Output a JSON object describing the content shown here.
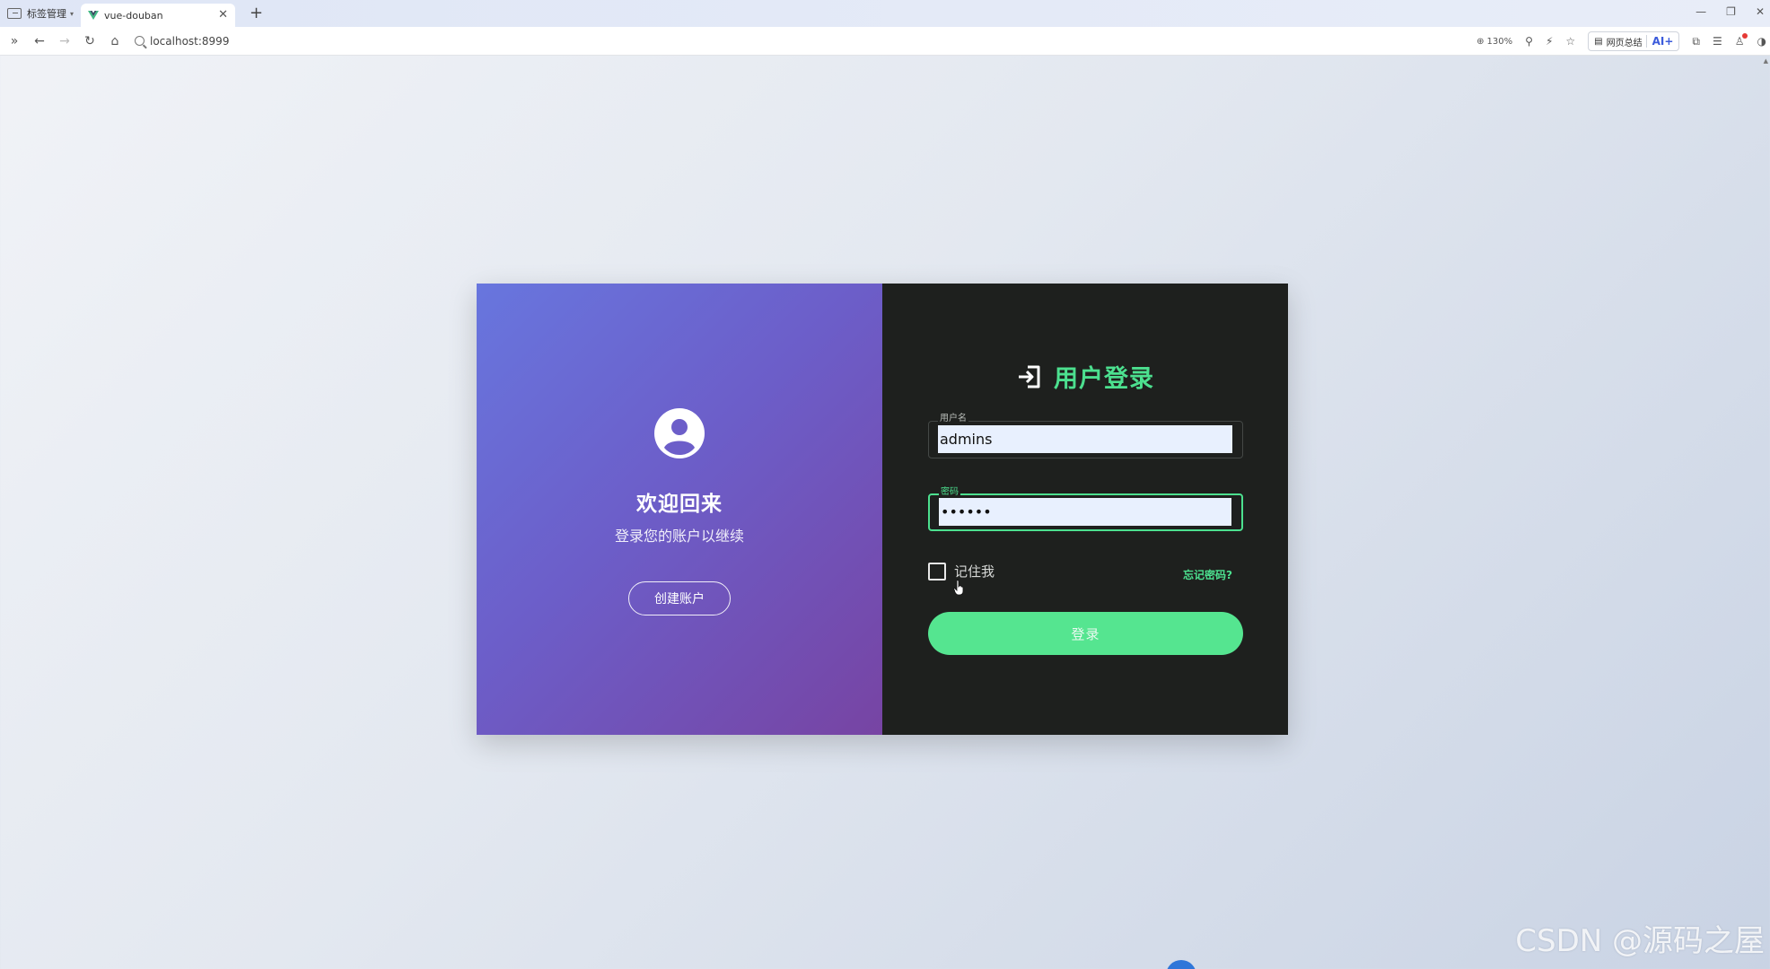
{
  "browser": {
    "tab_group_label": "标签管理",
    "tab_title": "vue-douban",
    "new_tab": "+",
    "url": "localhost:8999",
    "zoom": "130%",
    "summary_label": "网页总结",
    "ai_label": "AI+"
  },
  "login_card": {
    "left": {
      "welcome_title": "欢迎回来",
      "welcome_subtitle": "登录您的账户以继续",
      "create_account_label": "创建账户"
    },
    "right": {
      "title": "用户登录",
      "username_label": "用户名",
      "username_value": "admins",
      "password_label": "密码",
      "password_value": "••••••",
      "remember_label": "记住我",
      "forgot_label": "忘记密码?",
      "login_label": "登录"
    },
    "colors": {
      "accent_green": "#4ce08f",
      "left_gradient_start": "#6876de",
      "left_gradient_end": "#7744a3",
      "right_background": "#1e201e"
    }
  },
  "watermark": "CSDN @源码之屋"
}
